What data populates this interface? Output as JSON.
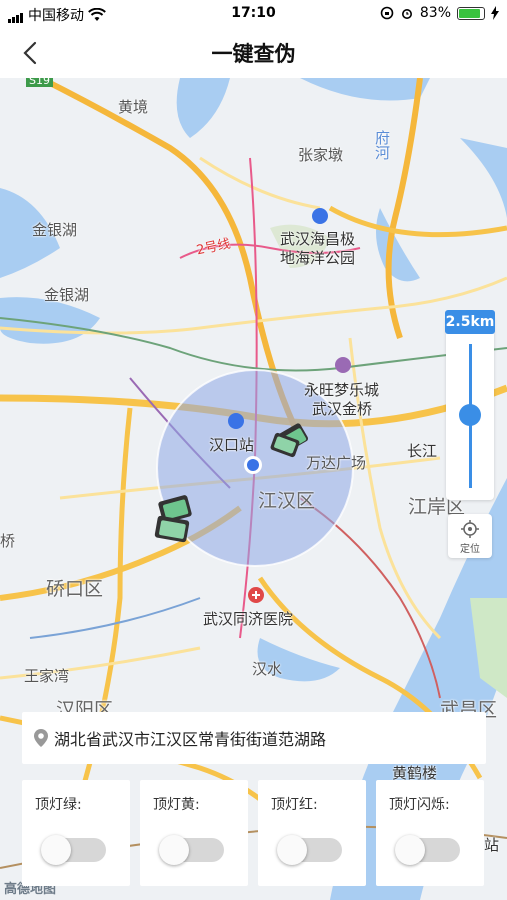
{
  "status_bar": {
    "carrier": "中国移动",
    "time": "17:10",
    "battery_percent": "83%",
    "battery_level": 0.83
  },
  "nav": {
    "title": "一键查伪",
    "back_icon": "chevron-left-icon"
  },
  "map": {
    "labels": {
      "s19": "S19",
      "huangjing": "黄境",
      "zhangjiadun": "张家墩",
      "fuhe": "府河",
      "jinyinhu1": "金银湖",
      "jinyinhu2": "金银湖",
      "line2": "2号线",
      "haichang1": "武汉海昌极",
      "haichang2": "地海洋公园",
      "yongwang1": "永旺梦乐城",
      "yongwang2": "武汉金桥",
      "hankouzhan": "汉口站",
      "wandaguangchang": "万达广场",
      "changjiang": "长江",
      "jianghanqu": "江汉区",
      "jianganqu": "江岸区",
      "qiao": "桥",
      "qiaokouqu": "硚口区",
      "tongji": "武汉同济医院",
      "wangjiawan": "王家湾",
      "hanshui": "汉水",
      "hanyangqu": "汉阳区",
      "wuchangqu": "武昌区",
      "huanghelou": "黄鹤楼",
      "zhan": "站",
      "logo": "高德地图"
    },
    "zoom_scale": "2.5km",
    "locate_label": "定位",
    "colors": {
      "accent": "#3a8ee6",
      "water": "#a9cdf2",
      "radius_circle": "#8fa8e6"
    }
  },
  "address": {
    "icon": "location-pin-icon",
    "text": "湖北省武汉市江汉区常青街街道范湖路"
  },
  "filters": [
    {
      "label": "顶灯绿:",
      "on": false
    },
    {
      "label": "顶灯黄:",
      "on": false
    },
    {
      "label": "顶灯红:",
      "on": false
    },
    {
      "label": "顶灯闪烁:",
      "on": false
    }
  ]
}
